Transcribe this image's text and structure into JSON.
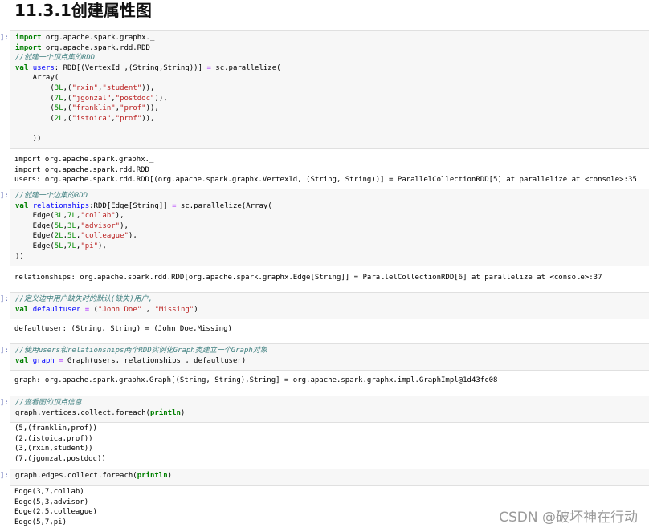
{
  "section_title": "11.3.1创建属性图",
  "cells": [
    {
      "prompt": "]:",
      "lines": [
        [
          [
            "kw",
            "import"
          ],
          [
            "t",
            " org.apache.spark.graphx._"
          ]
        ],
        [
          [
            "kw",
            "import"
          ],
          [
            "t",
            " org.apache.spark.rdd.RDD"
          ]
        ],
        [
          [
            "cm",
            "//创建一个顶点集的RDD"
          ]
        ],
        [
          [
            "kw",
            "val"
          ],
          [
            "t",
            " "
          ],
          [
            "nm",
            "users"
          ],
          [
            "t",
            ": RDD[(VertexId ,(String,String))] "
          ],
          [
            "op",
            "="
          ],
          [
            "t",
            " sc.parallelize("
          ]
        ],
        [
          [
            "t",
            "    Array("
          ]
        ],
        [
          [
            "t",
            "        ("
          ],
          [
            "num",
            "3L"
          ],
          [
            "t",
            ",("
          ],
          [
            "str",
            "\"rxin\""
          ],
          [
            "t",
            ","
          ],
          [
            "str",
            "\"student\""
          ],
          [
            "t",
            ")),"
          ]
        ],
        [
          [
            "t",
            "        ("
          ],
          [
            "num",
            "7L"
          ],
          [
            "t",
            ",("
          ],
          [
            "str",
            "\"jgonzal\""
          ],
          [
            "t",
            ","
          ],
          [
            "str",
            "\"postdoc\""
          ],
          [
            "t",
            ")),"
          ]
        ],
        [
          [
            "t",
            "        ("
          ],
          [
            "num",
            "5L"
          ],
          [
            "t",
            ",("
          ],
          [
            "str",
            "\"franklin\""
          ],
          [
            "t",
            ","
          ],
          [
            "str",
            "\"prof\""
          ],
          [
            "t",
            ")),"
          ]
        ],
        [
          [
            "t",
            "        ("
          ],
          [
            "num",
            "2L"
          ],
          [
            "t",
            ",("
          ],
          [
            "str",
            "\"istoica\""
          ],
          [
            "t",
            ","
          ],
          [
            "str",
            "\"prof\""
          ],
          [
            "t",
            ")),"
          ]
        ],
        [
          [
            "t",
            ""
          ]
        ],
        [
          [
            "t",
            "    ))"
          ]
        ]
      ],
      "output": [
        "import org.apache.spark.graphx._",
        "import org.apache.spark.rdd.RDD",
        "users: org.apache.spark.rdd.RDD[(org.apache.spark.graphx.VertexId, (String, String))] = ParallelCollectionRDD[5] at parallelize at <console>:35"
      ]
    },
    {
      "prompt": "]:",
      "lines": [
        [
          [
            "cm",
            "//创建一个边集的RDD"
          ]
        ],
        [
          [
            "kw",
            "val"
          ],
          [
            "t",
            " "
          ],
          [
            "nm",
            "relationships"
          ],
          [
            "t",
            ":RDD[Edge[String]] "
          ],
          [
            "op",
            "="
          ],
          [
            "t",
            " sc.parallelize(Array("
          ]
        ],
        [
          [
            "t",
            "    Edge("
          ],
          [
            "num",
            "3L"
          ],
          [
            "t",
            ","
          ],
          [
            "num",
            "7L"
          ],
          [
            "t",
            ","
          ],
          [
            "str",
            "\"collab\""
          ],
          [
            "t",
            "),"
          ]
        ],
        [
          [
            "t",
            "    Edge("
          ],
          [
            "num",
            "5L"
          ],
          [
            "t",
            ","
          ],
          [
            "num",
            "3L"
          ],
          [
            "t",
            ","
          ],
          [
            "str",
            "\"advisor\""
          ],
          [
            "t",
            "),"
          ]
        ],
        [
          [
            "t",
            "    Edge("
          ],
          [
            "num",
            "2L"
          ],
          [
            "t",
            ","
          ],
          [
            "num",
            "5L"
          ],
          [
            "t",
            ","
          ],
          [
            "str",
            "\"colleague\""
          ],
          [
            "t",
            "),"
          ]
        ],
        [
          [
            "t",
            "    Edge("
          ],
          [
            "num",
            "5L"
          ],
          [
            "t",
            ","
          ],
          [
            "num",
            "7L"
          ],
          [
            "t",
            ","
          ],
          [
            "str",
            "\"pi\""
          ],
          [
            "t",
            "),"
          ]
        ],
        [
          [
            "t",
            "))"
          ]
        ]
      ],
      "output": [
        "relationships: org.apache.spark.rdd.RDD[org.apache.spark.graphx.Edge[String]] = ParallelCollectionRDD[6] at parallelize at <console>:37"
      ]
    },
    {
      "prompt": "]:",
      "lines": [
        [
          [
            "cm",
            "//定义边中用户缺失时的默认(缺失)用户,"
          ]
        ],
        [
          [
            "kw",
            "val"
          ],
          [
            "t",
            " "
          ],
          [
            "nm",
            "defaultuser"
          ],
          [
            "t",
            " "
          ],
          [
            "op",
            "="
          ],
          [
            "t",
            " ("
          ],
          [
            "str",
            "\"John Doe\""
          ],
          [
            "t",
            " , "
          ],
          [
            "str",
            "\"Missing\""
          ],
          [
            "t",
            ")"
          ]
        ]
      ],
      "output": [
        "defaultuser: (String, String) = (John Doe,Missing)"
      ]
    },
    {
      "prompt": "]:",
      "lines": [
        [
          [
            "cm",
            "//使用users和relationships两个RDD实例化Graph类建立一个Graph对象"
          ]
        ],
        [
          [
            "kw",
            "val"
          ],
          [
            "t",
            " "
          ],
          [
            "nm",
            "graph"
          ],
          [
            "t",
            " "
          ],
          [
            "op",
            "="
          ],
          [
            "t",
            " Graph(users, relationships , defaultuser)"
          ]
        ]
      ],
      "output": [
        "graph: org.apache.spark.graphx.Graph[(String, String),String] = org.apache.spark.graphx.impl.GraphImpl@1d43fc08"
      ]
    },
    {
      "prompt": "]:",
      "lines": [
        [
          [
            "cm",
            "//查看图的顶点信息"
          ]
        ],
        [
          [
            "t",
            "graph.vertices.collect.foreach("
          ],
          [
            "bi",
            "println"
          ],
          [
            "t",
            ")"
          ]
        ]
      ],
      "output": [
        "(5,(franklin,prof))",
        "(2,(istoica,prof))",
        "(3,(rxin,student))",
        "(7,(jgonzal,postdoc))"
      ]
    },
    {
      "prompt": "]:",
      "lines": [
        [
          [
            "t",
            "graph.edges.collect.foreach("
          ],
          [
            "bi",
            "println"
          ],
          [
            "t",
            ")"
          ]
        ]
      ],
      "output": [
        "Edge(3,7,collab)",
        "Edge(5,3,advisor)",
        "Edge(2,5,colleague)",
        "Edge(5,7,pi)"
      ]
    }
  ],
  "watermark": "CSDN @破坏神在行动"
}
